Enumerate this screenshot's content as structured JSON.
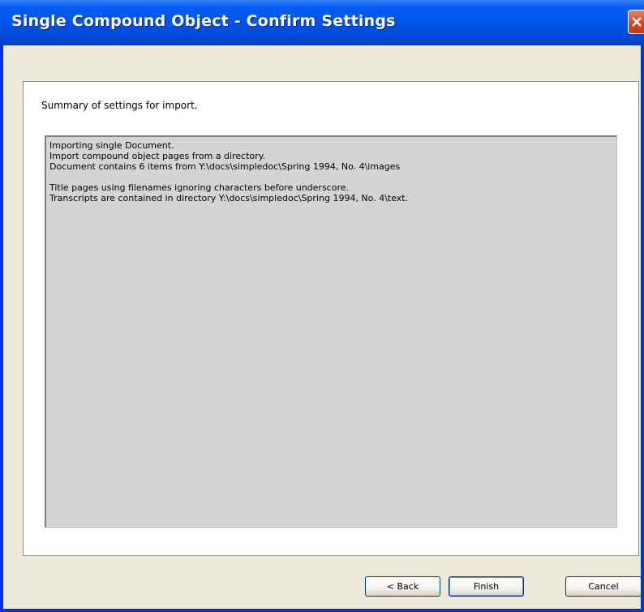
{
  "window": {
    "title": "Single Compound Object - Confirm Settings"
  },
  "summary": {
    "label": "Summary of settings for import.",
    "lines": [
      "Importing single Document.",
      "Import compound object pages from a directory.",
      "Document contains 6 items from Y:\\docs\\simpledoc\\Spring 1994, No. 4\\images",
      "",
      "Title pages using filenames ignoring characters before underscore.",
      "Transcripts are contained in directory Y:\\docs\\simpledoc\\Spring 1994, No. 4\\text."
    ]
  },
  "buttons": {
    "back": "< Back",
    "finish": "Finish",
    "cancel": "Cancel"
  },
  "icons": {
    "close": "close-icon"
  }
}
